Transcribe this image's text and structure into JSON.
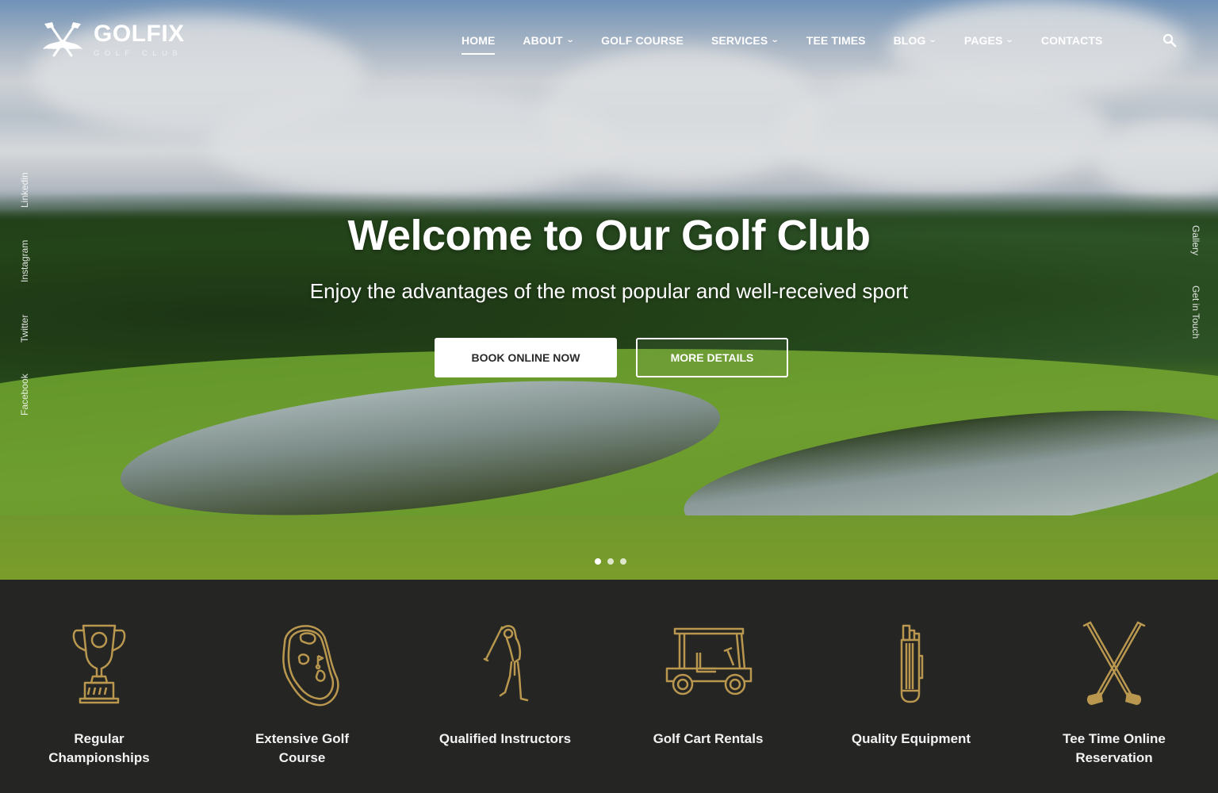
{
  "brand": {
    "name": "GOLFIX",
    "tagline": "GOLF CLUB"
  },
  "nav": {
    "items": [
      {
        "label": "HOME",
        "active": true,
        "has_dropdown": false
      },
      {
        "label": "ABOUT",
        "active": false,
        "has_dropdown": true
      },
      {
        "label": "GOLF COURSE",
        "active": false,
        "has_dropdown": false
      },
      {
        "label": "SERVICES",
        "active": false,
        "has_dropdown": true
      },
      {
        "label": "TEE TIMES",
        "active": false,
        "has_dropdown": false
      },
      {
        "label": "BLOG",
        "active": false,
        "has_dropdown": true
      },
      {
        "label": "PAGES",
        "active": false,
        "has_dropdown": true
      },
      {
        "label": "CONTACTS",
        "active": false,
        "has_dropdown": false
      }
    ],
    "chevron_glyph": "⌄",
    "search_icon": "search-icon"
  },
  "social_links": [
    "Linkedin",
    "Instagram",
    "Twitter",
    "Facebook"
  ],
  "side_right_links": [
    "Gallery",
    "Get in Touch"
  ],
  "hero": {
    "title": "Welcome to Our Golf Club",
    "subtitle": "Enjoy the advantages of the most popular and well-received sport",
    "primary_button": "BOOK ONLINE NOW",
    "secondary_button": "MORE DETAILS",
    "slides": 3,
    "active_slide": 1
  },
  "features": [
    {
      "icon": "trophy-icon",
      "label": "Regular Championships"
    },
    {
      "icon": "course-map-icon",
      "label": "Extensive Golf Course"
    },
    {
      "icon": "golfer-icon",
      "label": "Qualified Instructors"
    },
    {
      "icon": "golf-cart-icon",
      "label": "Golf Cart Rentals"
    },
    {
      "icon": "golf-bag-icon",
      "label": "Quality Equipment"
    },
    {
      "icon": "crossed-clubs-icon",
      "label": "Tee Time Online Reservation"
    }
  ],
  "colors": {
    "accent_gold": "#b9974f",
    "dark_band": "#252624",
    "white": "#ffffff"
  }
}
